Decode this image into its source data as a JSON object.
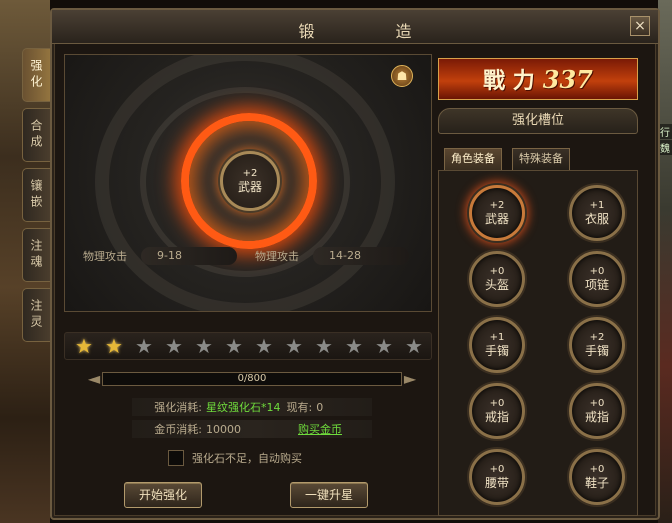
{
  "window": {
    "title": "锻 造",
    "close_icon": "×"
  },
  "side_tabs": [
    {
      "label": "强化",
      "active": true
    },
    {
      "label": "合成",
      "active": false
    },
    {
      "label": "镶嵌",
      "active": false
    },
    {
      "label": "注魂",
      "active": false
    },
    {
      "label": "注灵",
      "active": false
    }
  ],
  "scene": {
    "tag_1": "行",
    "tag_2": "魏"
  },
  "preview": {
    "item_level": "+2",
    "item_name": "武器",
    "emblem_icon": "☗",
    "stat_current_label": "物理攻击",
    "stat_current_value": "9-18",
    "stat_next_label": "物理攻击",
    "stat_next_value": "14-28"
  },
  "stars": {
    "filled": 2,
    "total": 12,
    "glyph": "★"
  },
  "progress": {
    "text": "0/800",
    "current": 0,
    "max": 800,
    "left_cap": "◄",
    "right_cap": "►"
  },
  "cost": {
    "material_label": "强化消耗:",
    "material_value": "星纹强化石*14",
    "have_label": "现有:",
    "have_value": "0",
    "gold_label": "金币消耗:",
    "gold_value": "10000",
    "buy_link": "购买金币"
  },
  "auto_buy_label": "强化石不足，自动购买",
  "buttons": {
    "start": "开始强化",
    "upstar": "一键升星"
  },
  "power": {
    "label": "戰 力",
    "value": "337"
  },
  "slot_panel": {
    "title": "强化槽位",
    "tabs": [
      "角色装备",
      "特殊装备"
    ],
    "slots": [
      {
        "level": "+2",
        "name": "武器",
        "active": true
      },
      {
        "level": "+1",
        "name": "衣服",
        "active": false
      },
      {
        "level": "+0",
        "name": "头盔",
        "active": false
      },
      {
        "level": "+0",
        "name": "项链",
        "active": false
      },
      {
        "level": "+1",
        "name": "手镯",
        "active": false
      },
      {
        "level": "+2",
        "name": "手镯",
        "active": false
      },
      {
        "level": "+0",
        "name": "戒指",
        "active": false
      },
      {
        "level": "+0",
        "name": "戒指",
        "active": false
      },
      {
        "level": "+0",
        "name": "腰带",
        "active": false
      },
      {
        "level": "+0",
        "name": "鞋子",
        "active": false
      }
    ]
  }
}
